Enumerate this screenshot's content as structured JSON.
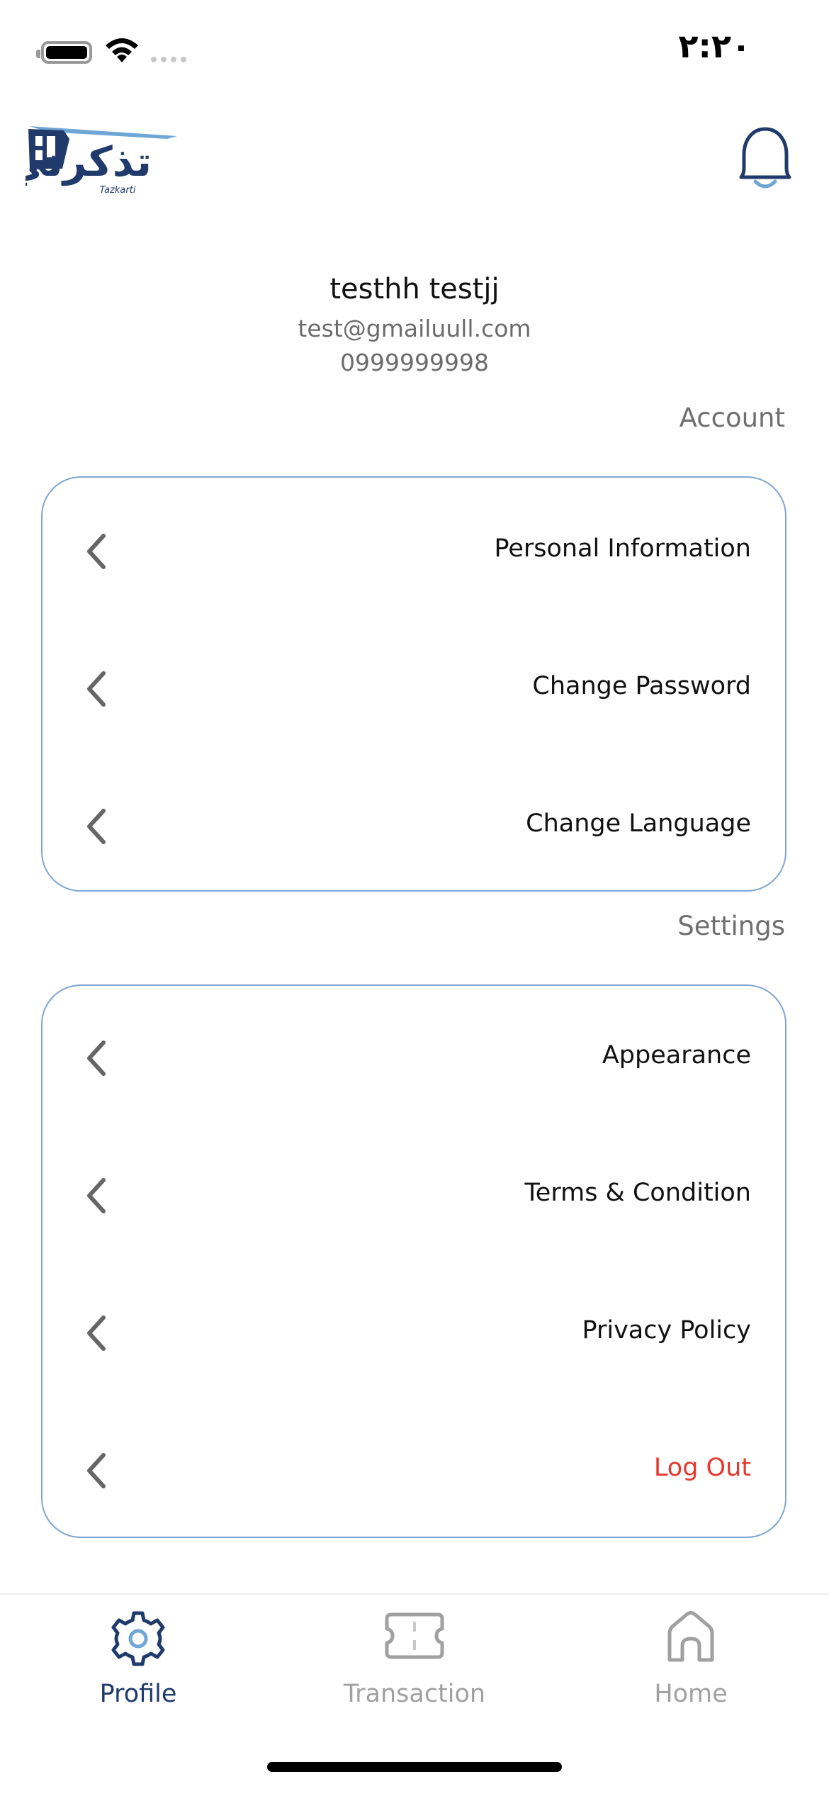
{
  "status": {
    "time": "٢:٢٠"
  },
  "header": {
    "logo_text": "تذكرتي",
    "logo_subtext": "Tazkarti"
  },
  "user": {
    "name": "testhh testjj",
    "email": "test@gmailuull.com",
    "phone": "0999999998"
  },
  "sections": {
    "account": {
      "title": "Account",
      "items": [
        {
          "label": "Personal Information"
        },
        {
          "label": "Change Password"
        },
        {
          "label": "Change Language"
        }
      ]
    },
    "settings": {
      "title": "Settings",
      "items": [
        {
          "label": "Appearance"
        },
        {
          "label": "Terms & Condition"
        },
        {
          "label": "Privacy Policy"
        },
        {
          "label": "Log Out"
        }
      ]
    }
  },
  "tabs": [
    {
      "label": "Profile",
      "icon": "gear-icon",
      "active": true
    },
    {
      "label": "Transaction",
      "icon": "ticket-icon",
      "active": false
    },
    {
      "label": "Home",
      "icon": "home-icon",
      "active": false
    }
  ],
  "colors": {
    "brand_dark": "#1f3a6b",
    "brand_light": "#6ea6d6",
    "card_border": "#7ea7d4",
    "danger": "#e8372c",
    "inactive": "#a0a0a0"
  }
}
